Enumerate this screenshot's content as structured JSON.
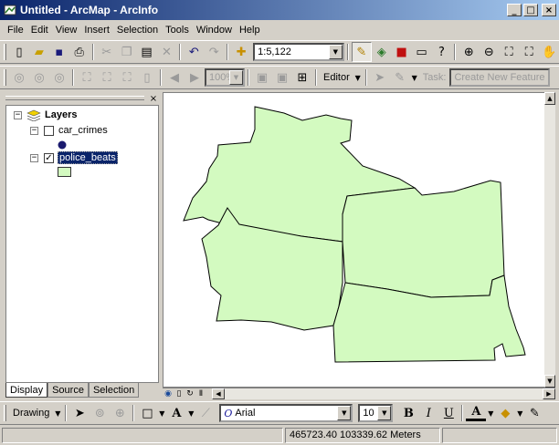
{
  "window": {
    "title": "Untitled - ArcMap - ArcInfo",
    "minimize": "_",
    "maximize": "□",
    "close": "×"
  },
  "menu": [
    "File",
    "Edit",
    "View",
    "Insert",
    "Selection",
    "Tools",
    "Window",
    "Help"
  ],
  "standard_toolbar": {
    "scale": "1:5,122"
  },
  "editor_toolbar": {
    "zoom": "100%",
    "editor_label": "Editor",
    "task_label": "Task:",
    "task_value": "Create New Feature"
  },
  "toc": {
    "close": "×",
    "root": "Layers",
    "layers": [
      {
        "name": "car_crimes",
        "checked": false,
        "symbol": "point",
        "color": "#1a1a6e"
      },
      {
        "name": "police_beats",
        "checked": true,
        "symbol": "polygon",
        "color": "#d3fac0"
      }
    ],
    "tabs": [
      "Display",
      "Source",
      "Selection"
    ]
  },
  "map": {
    "fill_color": "#d3fac0",
    "outline_color": "#000000"
  },
  "drawing_toolbar": {
    "drawing_label": "Drawing",
    "font": "Arial",
    "size": "10",
    "bold": "B",
    "italic": "I",
    "underline": "U"
  },
  "status": {
    "coordinates": "465723.40  103339.62 Meters"
  }
}
